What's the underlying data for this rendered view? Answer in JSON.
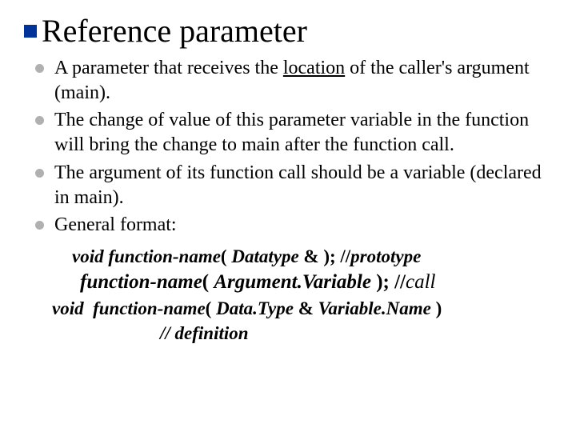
{
  "title": "Reference parameter",
  "bullets": [
    {
      "pre": "A parameter that receives the ",
      "u": "location",
      "post": " of the caller's argument (main)."
    },
    {
      "pre": "The change of value of this parameter variable in the function will bring the change to main after the function call.",
      "u": "",
      "post": ""
    },
    {
      "pre": "The argument of its function call should be a variable (declared in main).",
      "u": "",
      "post": ""
    },
    {
      "pre": "General format:",
      "u": "",
      "post": ""
    }
  ],
  "code": {
    "l1a": "void function-name",
    "l1b": "( ",
    "l1c": "Datatype",
    "l1d": " & ); //",
    "l1e": "prototype",
    "l2a": "function-name",
    "l2b": "( ",
    "l2c": "Argument.Variable",
    "l2d": " ); //",
    "l2e": "call",
    "l3a": "void  function-name",
    "l3b": "( ",
    "l3c": "Data.Type",
    "l3d": " & ",
    "l3e": "Variable.Name",
    "l3f": " )",
    "l4": "// definition"
  }
}
